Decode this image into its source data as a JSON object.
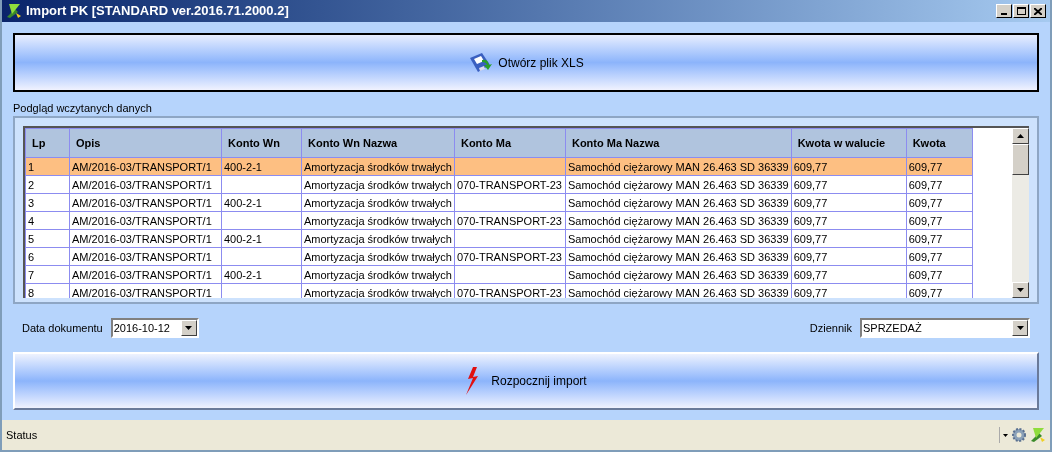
{
  "window": {
    "title": "Import PK [STANDARD ver.2016.71.2000.2]"
  },
  "open_button": {
    "label": "Otwórz plik XLS"
  },
  "preview_label": "Podgląd wczytanych danych",
  "table": {
    "columns": [
      "Lp",
      "Opis",
      "Konto Wn",
      "Konto Wn Nazwa",
      "Konto Ma",
      "Konto Ma Nazwa",
      "Kwota w walucie",
      "Kwota"
    ],
    "rows": [
      {
        "selected": true,
        "cells": [
          "1",
          "AM/2016-03/TRANSPORT/1",
          "400-2-1",
          "Amortyzacja środków trwałych",
          "",
          "Samochód ciężarowy MAN 26.463 SD 36339",
          "609,77",
          "609,77"
        ]
      },
      {
        "selected": false,
        "cells": [
          "2",
          "AM/2016-03/TRANSPORT/1",
          "",
          "Amortyzacja środków trwałych",
          "070-TRANSPORT-23",
          "Samochód ciężarowy MAN 26.463 SD 36339",
          "609,77",
          "609,77"
        ]
      },
      {
        "selected": false,
        "cells": [
          "3",
          "AM/2016-03/TRANSPORT/1",
          "400-2-1",
          "Amortyzacja środków trwałych",
          "",
          "Samochód ciężarowy MAN 26.463 SD 36339",
          "609,77",
          "609,77"
        ]
      },
      {
        "selected": false,
        "cells": [
          "4",
          "AM/2016-03/TRANSPORT/1",
          "",
          "Amortyzacja środków trwałych",
          "070-TRANSPORT-23",
          "Samochód ciężarowy MAN 26.463 SD 36339",
          "609,77",
          "609,77"
        ]
      },
      {
        "selected": false,
        "cells": [
          "5",
          "AM/2016-03/TRANSPORT/1",
          "400-2-1",
          "Amortyzacja środków trwałych",
          "",
          "Samochód ciężarowy MAN 26.463 SD 36339",
          "609,77",
          "609,77"
        ]
      },
      {
        "selected": false,
        "cells": [
          "6",
          "AM/2016-03/TRANSPORT/1",
          "",
          "Amortyzacja środków trwałych",
          "070-TRANSPORT-23",
          "Samochód ciężarowy MAN 26.463 SD 36339",
          "609,77",
          "609,77"
        ]
      },
      {
        "selected": false,
        "cells": [
          "7",
          "AM/2016-03/TRANSPORT/1",
          "400-2-1",
          "Amortyzacja środków trwałych",
          "",
          "Samochód ciężarowy MAN 26.463 SD 36339",
          "609,77",
          "609,77"
        ]
      },
      {
        "selected": false,
        "cells": [
          "8",
          "AM/2016-03/TRANSPORT/1",
          "",
          "Amortyzacja środków trwałych",
          "070-TRANSPORT-23",
          "Samochód ciężarowy MAN 26.463 SD 36339",
          "609,77",
          "609,77"
        ]
      }
    ]
  },
  "date_field": {
    "label": "Data dokumentu",
    "value": "2016-10-12"
  },
  "journal_field": {
    "label": "Dziennik",
    "value": "SPRZEDAŻ"
  },
  "import_button": {
    "label": "Rozpocznij import"
  },
  "status_bar": {
    "text": "Status"
  }
}
